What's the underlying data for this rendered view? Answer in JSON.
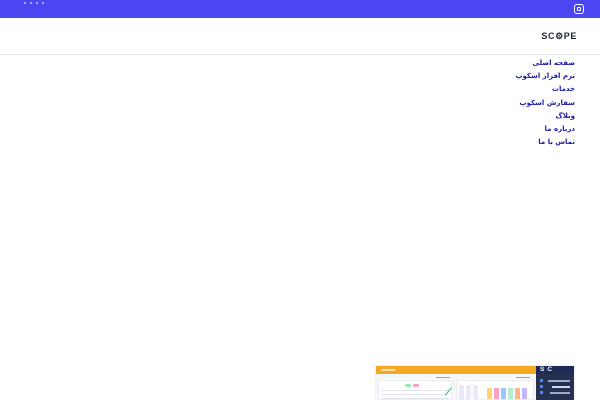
{
  "brand": {
    "logo_text": "SC⚙PE"
  },
  "topbar": {
    "icon": "app-grid-icon",
    "dots": 4
  },
  "nav": {
    "items": [
      {
        "label": "صفحه اصلی"
      },
      {
        "label": "نرم افزار اسکوپ"
      },
      {
        "label": "خدمات"
      },
      {
        "label": "سفارش اسکوپ"
      },
      {
        "label": "وبلاگ"
      },
      {
        "label": "درباره ما"
      },
      {
        "label": "تماس با ما"
      }
    ]
  },
  "colors": {
    "topbar": "#4b46f2",
    "nav_link": "#1a1aa8",
    "preview_orange": "#f7a823",
    "preview_navy": "#1d2a5a"
  },
  "preview": {
    "logo_text": "SC PE"
  }
}
